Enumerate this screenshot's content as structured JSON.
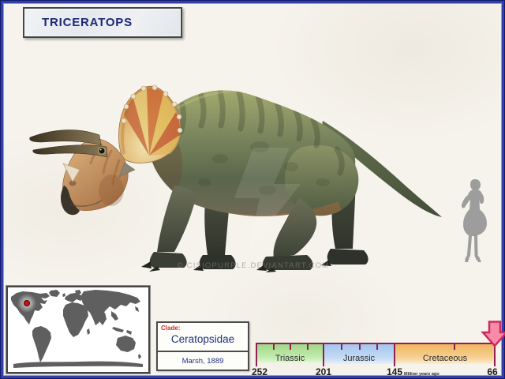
{
  "header": {
    "title": "TRICERATOPS"
  },
  "illustration": {
    "subject": "Triceratops side-view restoration",
    "watermark": "© CISIOPURPLE.DEVIANTART.COM"
  },
  "clade_box": {
    "label": "Clade:",
    "value": "Ceratopsidae",
    "authority": "Marsh, 1889"
  },
  "location_map": {
    "marker_icon": "location-dot",
    "marker_color": "#cc1111",
    "marker_region": "western North America"
  },
  "timeline": {
    "unit_label": "Million years ago",
    "boundaries": [
      "252",
      "201",
      "145",
      "66"
    ],
    "periods": [
      {
        "name": "Triassic",
        "color": "#9ed885"
      },
      {
        "name": "Jurassic",
        "color": "#a3c6ee"
      },
      {
        "name": "Cretaceous",
        "color": "#f0b45e"
      }
    ],
    "marker_icon": "down-arrow",
    "marker_color": "#fa8ba6"
  },
  "colors": {
    "page_border": "#2f3fb0",
    "timeline_line": "#8e2054",
    "title_text": "#1c2878",
    "clade_label_red": "#c23427",
    "background": "#f6f3ec"
  }
}
